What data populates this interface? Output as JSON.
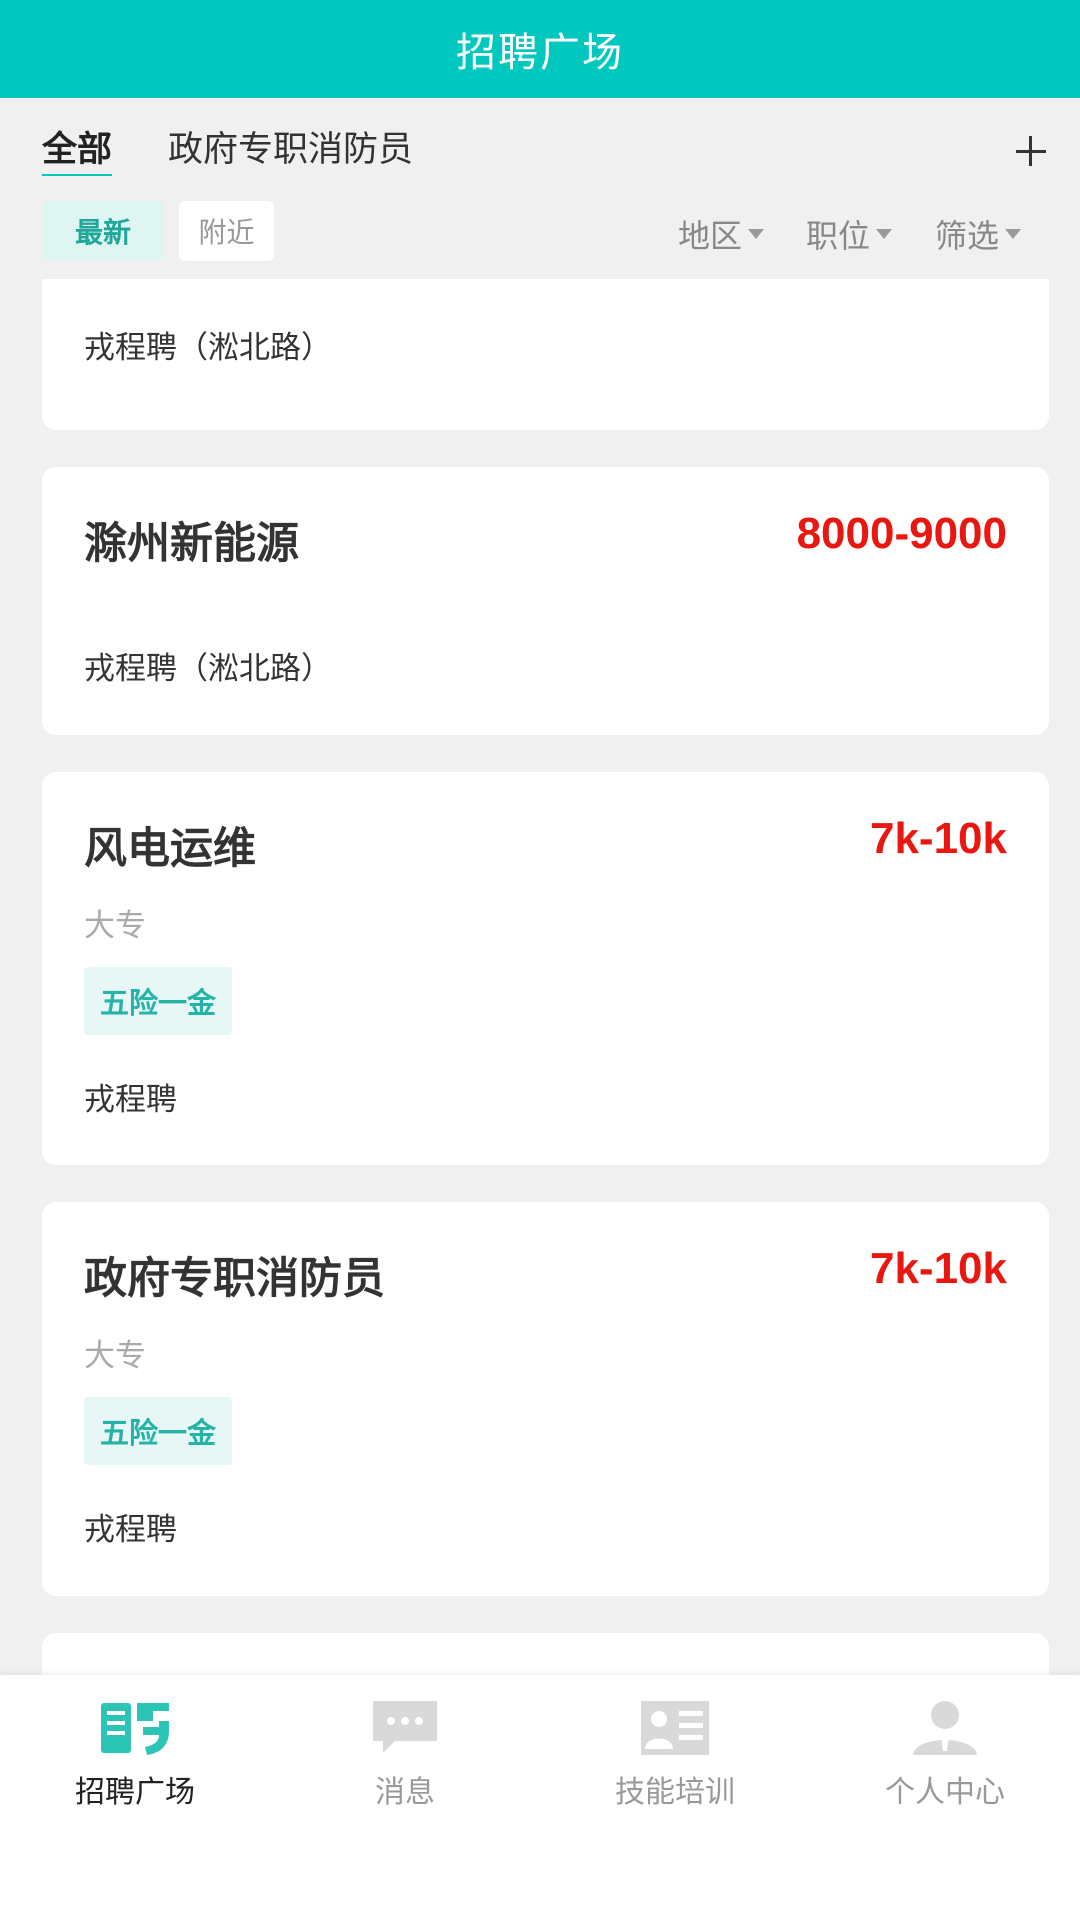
{
  "header": {
    "title": "招聘广场"
  },
  "tabs": {
    "all": "全部",
    "fire": "政府专职消防员"
  },
  "filters": {
    "latest": "最新",
    "nearby": "附近",
    "region": "地区",
    "position": "职位",
    "filter": "筛选"
  },
  "jobs": [
    {
      "company": "戎程聘（淞北路）"
    },
    {
      "title": "滁州新能源",
      "salary": "8000-9000",
      "company": "戎程聘（淞北路）"
    },
    {
      "title": "风电运维",
      "salary": "7k-10k",
      "education": "大专",
      "tag": "五险一金",
      "company": "戎程聘"
    },
    {
      "title": "政府专职消防员",
      "salary": "7k-10k",
      "education": "大专",
      "tag": "五险一金",
      "company": "戎程聘"
    }
  ],
  "tabbar": {
    "recruit": "招聘广场",
    "messages": "消息",
    "training": "技能培训",
    "profile": "个人中心"
  },
  "colors": {
    "accent": "#00c8bf",
    "salary": "#e8170f",
    "tag_bg": "#e6f7f5",
    "tag_text": "#24b3a6"
  },
  "icons": [
    "recruit-icon",
    "message-icon",
    "training-icon",
    "user-icon",
    "plus-icon",
    "caret-down-icon"
  ]
}
